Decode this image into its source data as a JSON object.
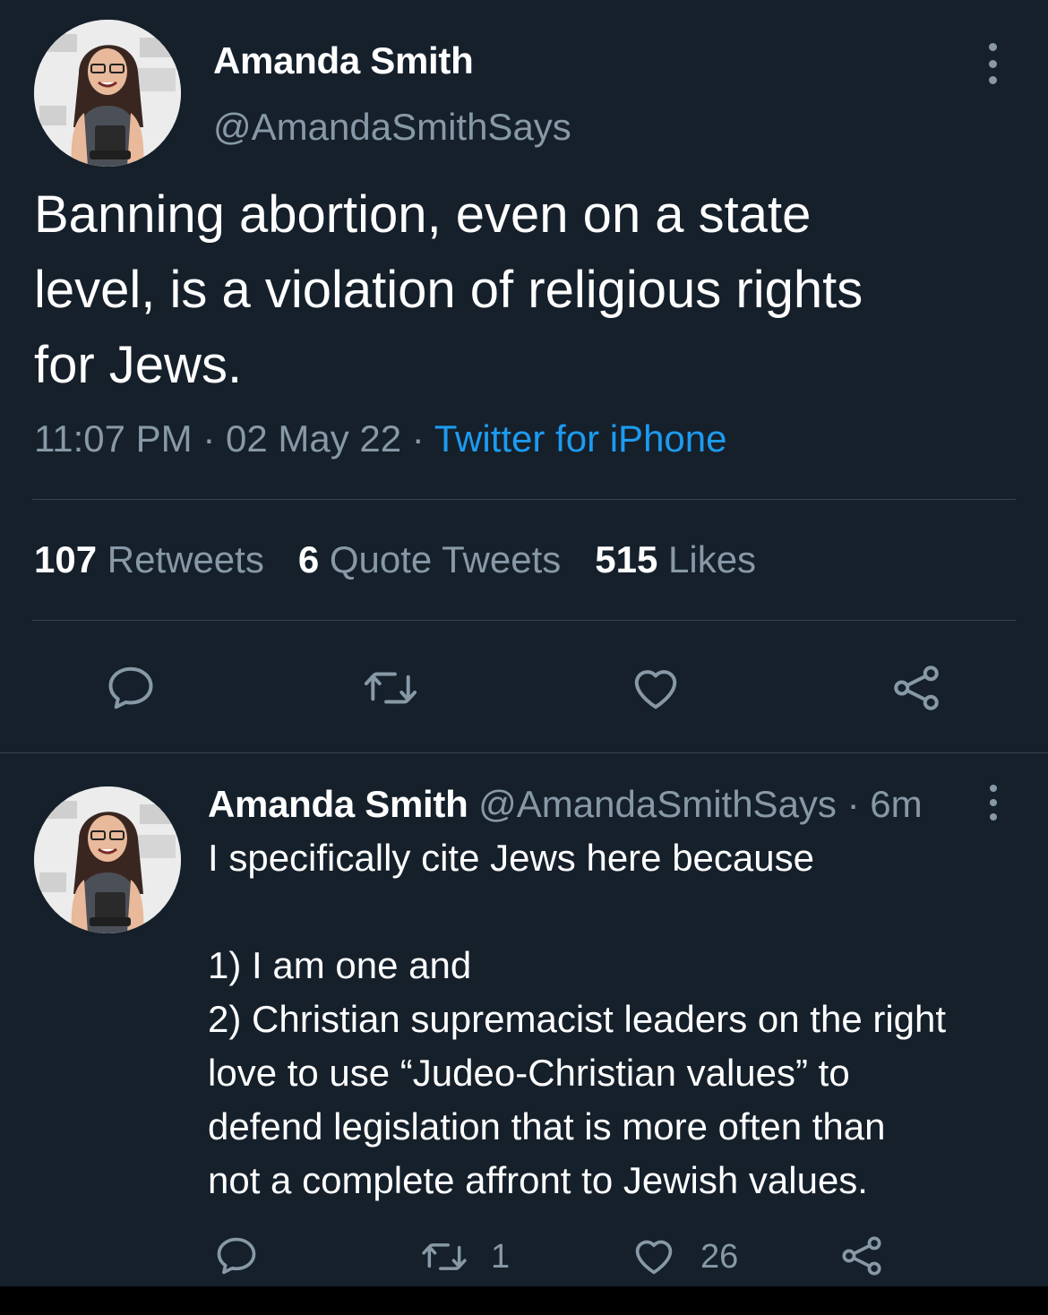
{
  "main_tweet": {
    "author_name": "Amanda Smith",
    "author_handle": "@AmandaSmithSays",
    "text_lines": [
      "Banning abortion, even on a state",
      "level, is a violation of religious rights",
      "for Jews."
    ],
    "time": "11:07 PM",
    "separator": " · ",
    "date": "02 May 22",
    "source": "Twitter for iPhone",
    "stats": {
      "retweets_count": "107",
      "retweets_label": "Retweets",
      "quotes_count": "6",
      "quotes_label": "Quote Tweets",
      "likes_count": "515",
      "likes_label": "Likes"
    },
    "actions": [
      "reply-icon",
      "retweet-icon",
      "like-icon",
      "share-icon"
    ]
  },
  "reply_tweet": {
    "author_name": "Amanda Smith",
    "author_handle": "@AmandaSmithSays",
    "age": "· 6m",
    "text_lines": [
      "I specifically cite Jews here because",
      "",
      "1) I am one and",
      "2) Christian supremacist leaders on the right",
      "love to use “Judeo-Christian values” to",
      "defend legislation that is more often than",
      "not a complete affront to Jewish values."
    ],
    "retweet_count": "1",
    "like_count": "26"
  },
  "colors": {
    "background": "#15202b",
    "secondary_text": "#8899a6",
    "accent": "#1d9bf0",
    "divider": "#38444d"
  }
}
